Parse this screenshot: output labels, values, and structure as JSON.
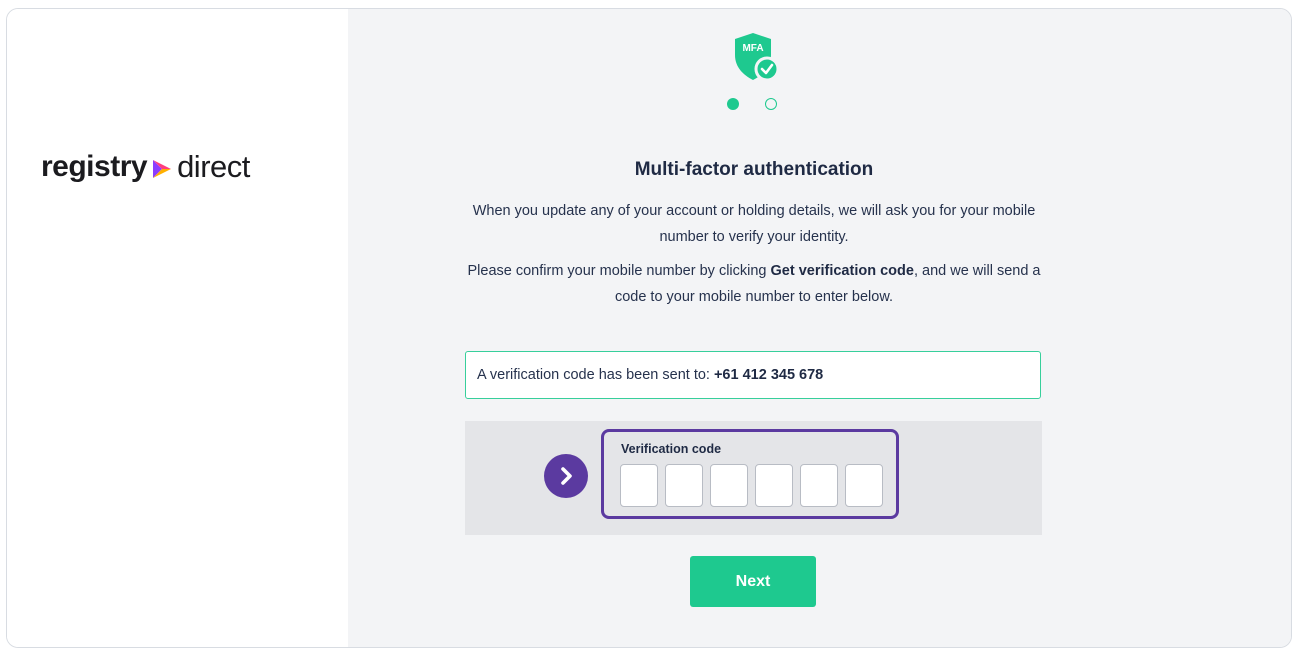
{
  "brand": {
    "name_bold": "registry",
    "name_light": "direct",
    "arrow_colors": [
      "#ff3d7f",
      "#8b3dff",
      "#ffb000"
    ]
  },
  "badge": {
    "label": "MFA",
    "icon": "shield-check-icon",
    "color": "#1ec98f"
  },
  "steps": {
    "total": 2,
    "current": 1
  },
  "title": "Multi-factor authentication",
  "intro": "When you update any of your account or holding details, we will ask you for your mobile number to verify your identity.",
  "instructions": {
    "before": "Please confirm your mobile number by clicking ",
    "bold": "Get verification code",
    "after": ", and we will send a code to your mobile number to enter below."
  },
  "notice": {
    "text": "A verification code has been sent to:",
    "phone": "+61 412 345 678"
  },
  "verification": {
    "label": "Verification code",
    "digits": [
      "",
      "",
      "",
      "",
      "",
      ""
    ]
  },
  "pointer": {
    "icon": "chevron-right-icon",
    "color": "#5b3aa0"
  },
  "next_button": {
    "label": "Next",
    "color": "#1ec98f"
  }
}
